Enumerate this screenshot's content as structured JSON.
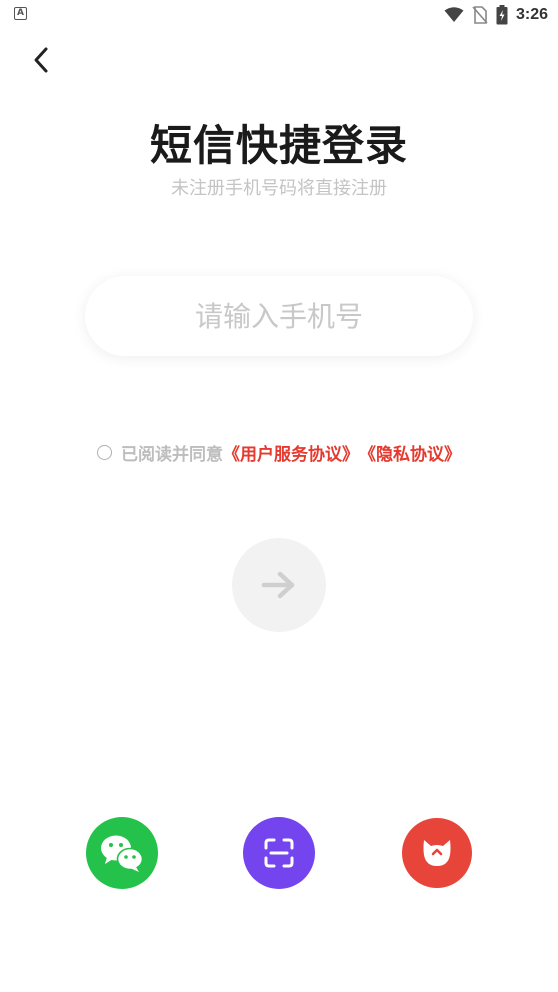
{
  "status_bar": {
    "left_icon": "A",
    "time": "3:26",
    "icons": [
      "wifi-icon",
      "no-sim-icon",
      "battery-charging-icon"
    ]
  },
  "header": {
    "back_icon": "chevron-left-icon"
  },
  "login": {
    "title": "短信快捷登录",
    "subtitle": "未注册手机号码将直接注册",
    "phone_placeholder": "请输入手机号",
    "phone_value": ""
  },
  "agreement": {
    "checked": false,
    "prefix": "已阅读并同意",
    "user_agreement": "《用户服务协议》",
    "privacy_policy": "《隐私协议》"
  },
  "next_button": {
    "icon": "arrow-right-icon",
    "enabled": false
  },
  "third_party": [
    {
      "name": "wechat",
      "icon": "wechat-icon",
      "color": "#24c24a"
    },
    {
      "name": "scan",
      "icon": "scan-icon",
      "color": "#7445ef"
    },
    {
      "name": "cat",
      "icon": "cat-icon",
      "color": "#e8453a"
    }
  ],
  "colors": {
    "accent_red": "#e53a2f",
    "placeholder": "#c8c8c8",
    "title": "#1a1a1a"
  }
}
